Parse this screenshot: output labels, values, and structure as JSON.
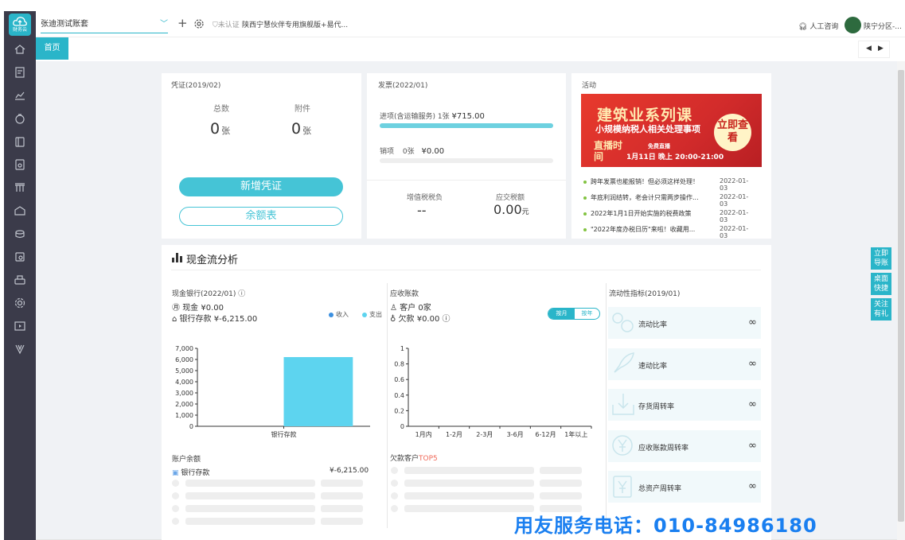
{
  "sidebar": {
    "logo_label": "财务云",
    "icons": [
      "home-icon",
      "voucher-icon",
      "report-icon",
      "invoice-icon",
      "ledger-icon",
      "tax-icon",
      "asset-icon",
      "archive-icon",
      "salary-icon",
      "inventory-icon",
      "print-icon",
      "settings-icon",
      "video-icon",
      "vip-icon"
    ]
  },
  "header": {
    "account": "张迪测试账套",
    "cert_status": "未认证",
    "company": "陕西宁慧伙伴专用旗舰版+易代...",
    "consult": "人工咨询",
    "user": "陕宁分区-..."
  },
  "tabs": {
    "home": "首页"
  },
  "voucher": {
    "title": "凭证(2019/02)",
    "total_label": "总数",
    "total_value": "0",
    "total_unit": "张",
    "attach_label": "附件",
    "attach_value": "0",
    "attach_unit": "张",
    "add_button": "新增凭证",
    "balance_button": "余额表"
  },
  "invoice": {
    "title": "发票(2022/01)",
    "in_label": "进项(含运输服务)",
    "in_count": "1张",
    "in_amount": "¥715.00",
    "in_fill": 1.0,
    "out_label": "销项",
    "out_count": "0张",
    "out_amount": "¥0.00",
    "out_fill": 0.0,
    "vat_label": "增值税税负",
    "vat_value": "--",
    "tax_label": "应交税额",
    "tax_value": "0.00",
    "tax_unit": "元"
  },
  "activity": {
    "title": "活动",
    "banner_title": "建筑业系列课",
    "banner_sub": "小规模纳税人相关处理事项",
    "banner_live": "直播时间",
    "banner_date": "1月11日 晚上 20:00-21:00",
    "banner_free": "免费直播",
    "banner_cta": "立即查看",
    "news": [
      {
        "text": "跨年发票也能报销！但必须这样处理！",
        "date": "2022-01-03"
      },
      {
        "text": "年底利润结转，老会计只需两步操作...",
        "date": "2022-01-03"
      },
      {
        "text": "2022年1月1日开始实施的税费政策",
        "date": "2022-01-03"
      },
      {
        "text": "\"2022年度办税日历\"来啦！收藏用...",
        "date": "2022-01-03"
      }
    ]
  },
  "cashflow": {
    "title": "现金流分析",
    "bank": {
      "title": "现金银行(2022/01)",
      "cash_label": "现金",
      "cash_value": "¥0.00",
      "bank_label": "银行存款",
      "bank_value": "¥-6,215.00",
      "legend_in": "收入",
      "legend_out": "支出",
      "balance_title": "账户余额",
      "balance_row_label": "银行存款",
      "balance_row_value": "¥-6,215.00"
    },
    "receivable": {
      "title": "应收账款",
      "customer_label": "客户",
      "customer_value": "0家",
      "debt_label": "欠款",
      "debt_value": "¥0.00",
      "toggle_on": "按月",
      "toggle_off": "按年",
      "top5_prefix": "欠款客户",
      "top5_suffix": "TOP5"
    },
    "liquidity": {
      "title": "流动性指标(2019/01)",
      "items": [
        {
          "label": "流动比率",
          "value": "∞"
        },
        {
          "label": "速动比率",
          "value": "∞"
        },
        {
          "label": "存货周转率",
          "value": "∞"
        },
        {
          "label": "应收账款周转率",
          "value": "∞"
        },
        {
          "label": "总资产周转率",
          "value": "∞"
        }
      ]
    }
  },
  "float_buttons": [
    "立即导账",
    "桌面快捷",
    "关注有礼"
  ],
  "watermark": "用友服务电话：010-84986180",
  "chart_data": [
    {
      "type": "bar",
      "categories": [
        "银行存款"
      ],
      "series": [
        {
          "name": "支出",
          "values": [
            6215
          ]
        }
      ],
      "ylim": [
        0,
        7000
      ],
      "yticks": [
        "0",
        "1,000",
        "2,000",
        "3,000",
        "4,000",
        "5,000",
        "6,000",
        "7,000"
      ],
      "colors": {
        "收入": "#3b8fe0",
        "支出": "#5dd4ef"
      }
    },
    {
      "type": "bar",
      "categories": [
        "1月内",
        "1-2月",
        "2-3月",
        "3-6月",
        "6-12月",
        "1年以上"
      ],
      "values": [
        0,
        0,
        0,
        0,
        0,
        0
      ],
      "ylim": [
        0,
        1
      ],
      "yticks": [
        "0",
        "0.2",
        "0.4",
        "0.6",
        "0.8",
        "1"
      ]
    }
  ]
}
